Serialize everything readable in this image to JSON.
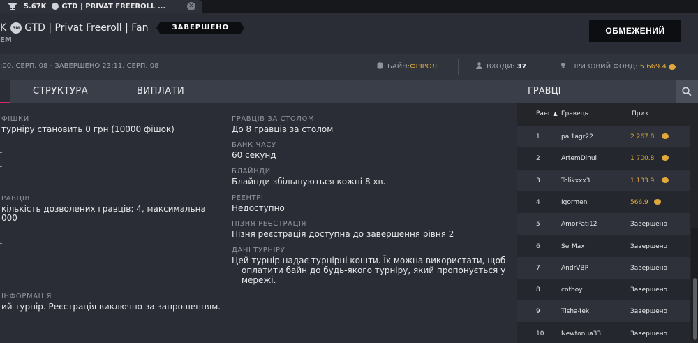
{
  "tab": {
    "title_prefix": "5.67K",
    "title": "GTD | PRIVAT FREEROLL ..."
  },
  "header": {
    "title_prefix": "K",
    "chip_label": "3M",
    "title": "GTD | Privat Freeroll | Fan",
    "status": "ЗАВЕРШЕНО",
    "subtitle": "EM",
    "limit_button": "ОБМЕЖЕНИЙ"
  },
  "infobar": {
    "times": ":00, СЕРП. 08 - ЗАВЕРШЕНО 23:11, СЕРП. 08",
    "buyin_label": "БАЙН:",
    "buyin_value": "ФРІРОЛ",
    "entries_label": "ВХОДИ:",
    "entries_value": "37",
    "prize_label": "ПРИЗОВИЙ ФОНД:",
    "prize_value": "5 669.4"
  },
  "nav": {
    "tabs": [
      "СТРУКТУРА",
      "ВИПЛАТИ"
    ]
  },
  "players_panel": {
    "title": "ГРАВЦІ",
    "columns": {
      "rank": "Ранг",
      "player": "Гравець",
      "prize": "Приз"
    },
    "rows": [
      {
        "rank": "1",
        "name": "pal1agr22",
        "prize": "2 267.8",
        "paid": true
      },
      {
        "rank": "2",
        "name": "ArtemDinul",
        "prize": "1 700.8",
        "paid": true
      },
      {
        "rank": "3",
        "name": "Tolikxxx3",
        "prize": "1 133.9",
        "paid": true
      },
      {
        "rank": "4",
        "name": "Igormen",
        "prize": "566.9",
        "paid": true
      },
      {
        "rank": "5",
        "name": "AmorFati12",
        "prize": "Завершено",
        "paid": false
      },
      {
        "rank": "6",
        "name": "SerMax",
        "prize": "Завершено",
        "paid": false
      },
      {
        "rank": "7",
        "name": "AndrVBP",
        "prize": "Завершено",
        "paid": false
      },
      {
        "rank": "8",
        "name": "cotboy",
        "prize": "Завершено",
        "paid": false
      },
      {
        "rank": "9",
        "name": "Tisha4ek",
        "prize": "Завершено",
        "paid": false
      },
      {
        "rank": "10",
        "name": "Newtonua33",
        "prize": "Завершено",
        "paid": false
      }
    ]
  },
  "left_col": {
    "chips_label": "ФІШКИ",
    "chips_value": "турніру становить 0 грн (10000 фішок)",
    "players_label": "РАВЦІВ",
    "players_value_1": "кількість дозволених гравців: 4, максимальна",
    "players_value_2": "000",
    "info_label": "ІНФОРМАЦІЯ",
    "info_value": "ий турнір. Реєстрація виключно за запрошенням."
  },
  "right_col": {
    "table_label": "ГРАВЦІВ ЗА СТОЛОМ",
    "table_value": "До 8 гравців за столом",
    "timebank_label": "БАНК ЧАСУ",
    "timebank_value": "60 секунд",
    "blinds_label": "БЛАЙНДИ",
    "blinds_value": "Блайнди збільшуються кожні 8 хв.",
    "reentry_label": "РЕЕНТРІ",
    "reentry_value": "Недоступно",
    "latereg_label": "ПІЗНЯ РЕЄСТРАЦІЯ",
    "latereg_value": "Пізня реєстрація доступна до завершення рівня 2",
    "data_label": "ДАНІ ТУРНІРУ",
    "data_value_1": "Цей турнір надає турнірні кошти. Їх можна використати, щоб",
    "data_value_2": "оплатити байн до будь-якого турніру, який пропонується у",
    "data_value_3": "мережі."
  },
  "colors": {
    "accent": "#d6246e",
    "gold": "#e0a93a",
    "background": "#2a2d35"
  }
}
